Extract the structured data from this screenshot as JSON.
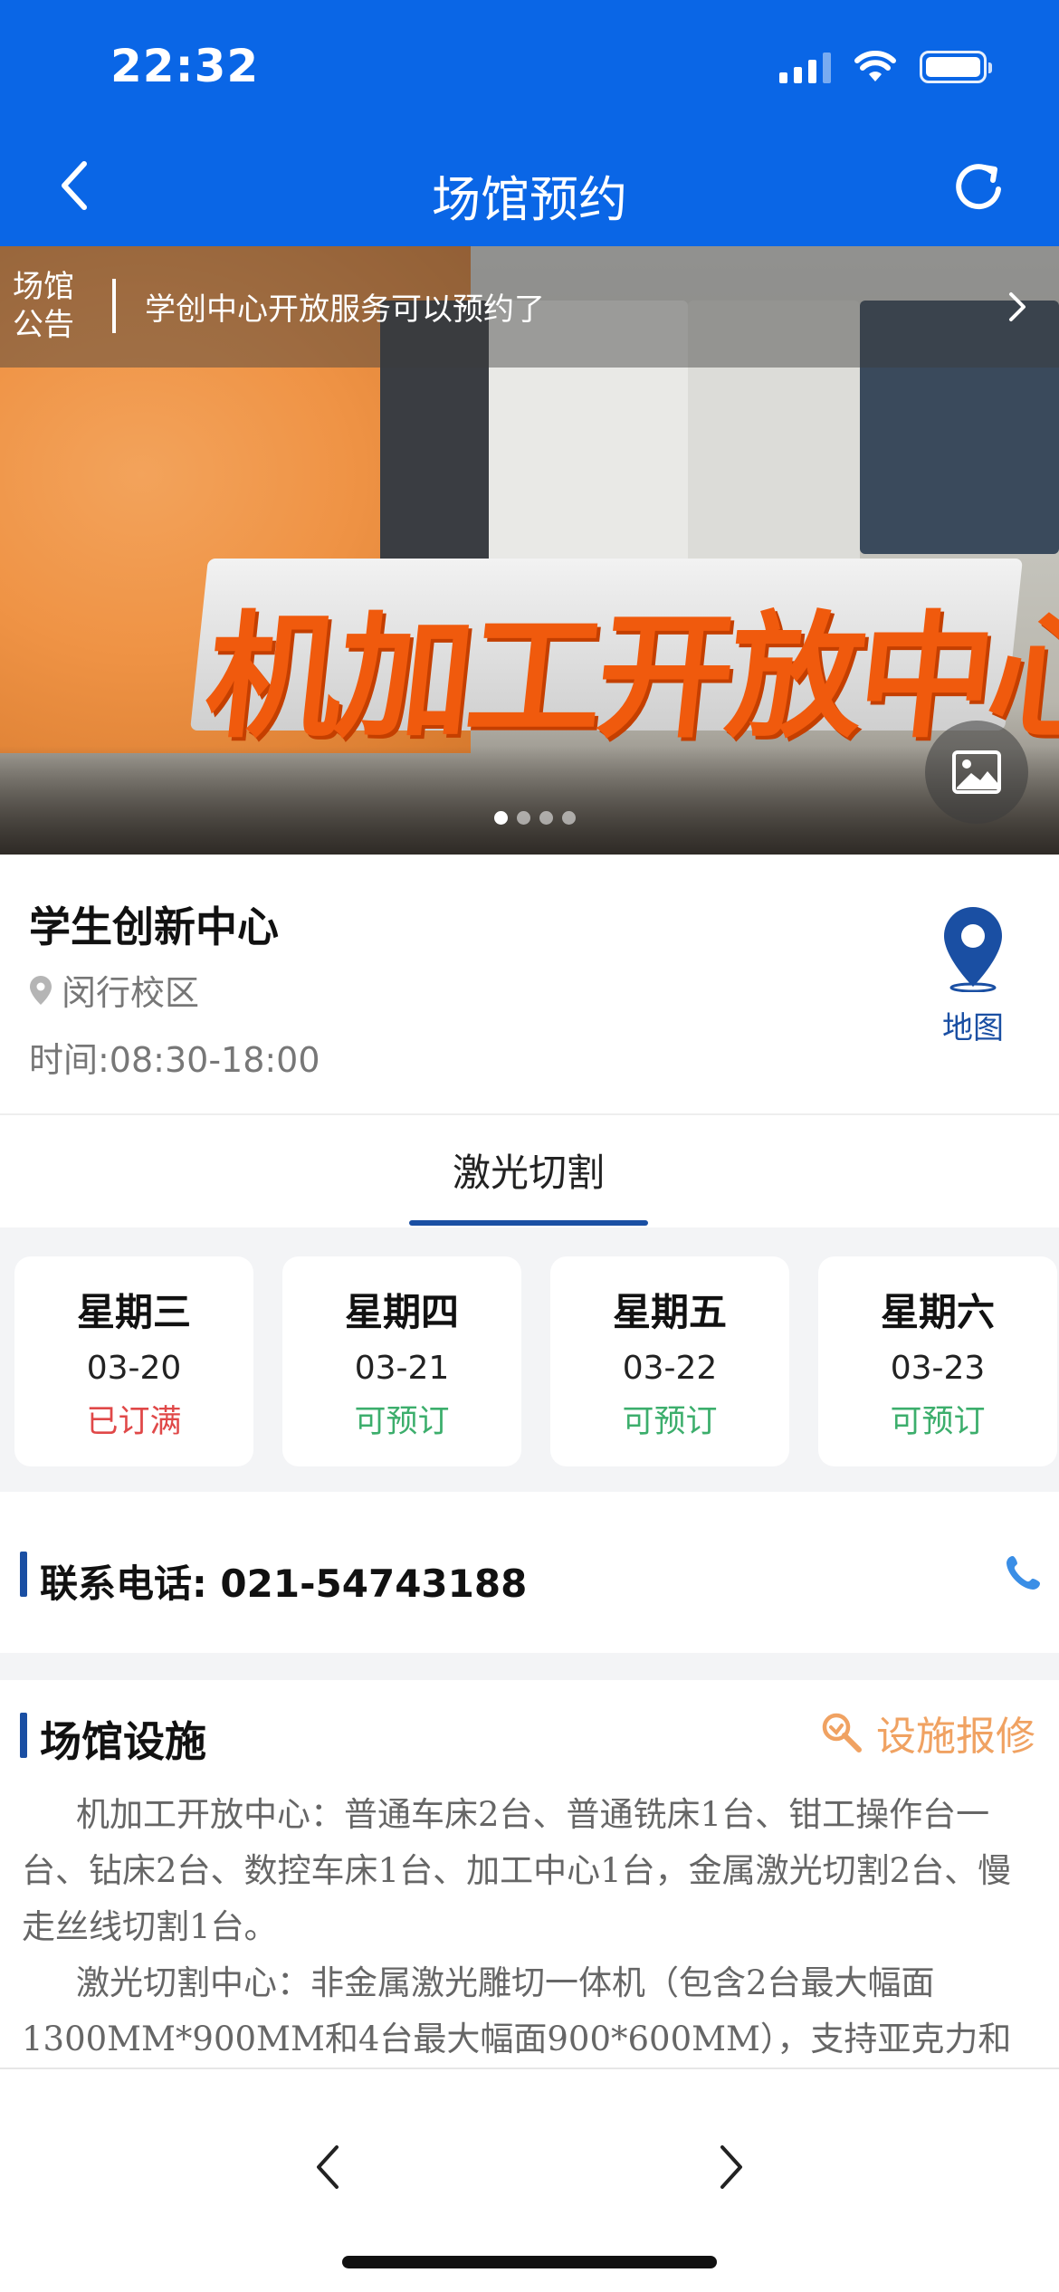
{
  "status_bar": {
    "time": "22:32"
  },
  "nav": {
    "title": "场馆预约"
  },
  "notice": {
    "label": "场馆公告",
    "text": "学创中心开放服务可以预约了"
  },
  "banner": {
    "sign_text": "机加工开放中心",
    "slide_count": 4,
    "active_slide": 1
  },
  "venue": {
    "name": "学生创新中心",
    "campus": "闵行校区",
    "hours": "时间:08:30-18:00",
    "map_label": "地图"
  },
  "tabs": [
    {
      "label": "激光切割",
      "selected": true
    }
  ],
  "dates": [
    {
      "day": "星期三",
      "date": "03-20",
      "status": "已订满",
      "available": false
    },
    {
      "day": "星期四",
      "date": "03-21",
      "status": "可预订",
      "available": true
    },
    {
      "day": "星期五",
      "date": "03-22",
      "status": "可预订",
      "available": true
    },
    {
      "day": "星期六",
      "date": "03-23",
      "status": "可预订",
      "available": true
    }
  ],
  "contact": {
    "label": "联系电话: 021-54743188"
  },
  "facilities": {
    "title": "场馆设施",
    "repair_label": "设施报修",
    "paragraphs": [
      "机加工开放中心：普通车床2台、普通铣床1台、钳工操作台一台、钻床2台、数控车床1台、加工中心1台，金属激光切割2台、慢走丝线切割1台。",
      "激光切割中心：非金属激光雕切一体机（包含2台最大幅面1300MM*900MM和4台最大幅面900*600MM），支持亚克力和"
    ]
  },
  "colors": {
    "primary": "#0a66e6",
    "accent_blue": "#1a4fa3",
    "full": "#e04848",
    "open": "#3cae6c",
    "repair": "#f0a262"
  }
}
